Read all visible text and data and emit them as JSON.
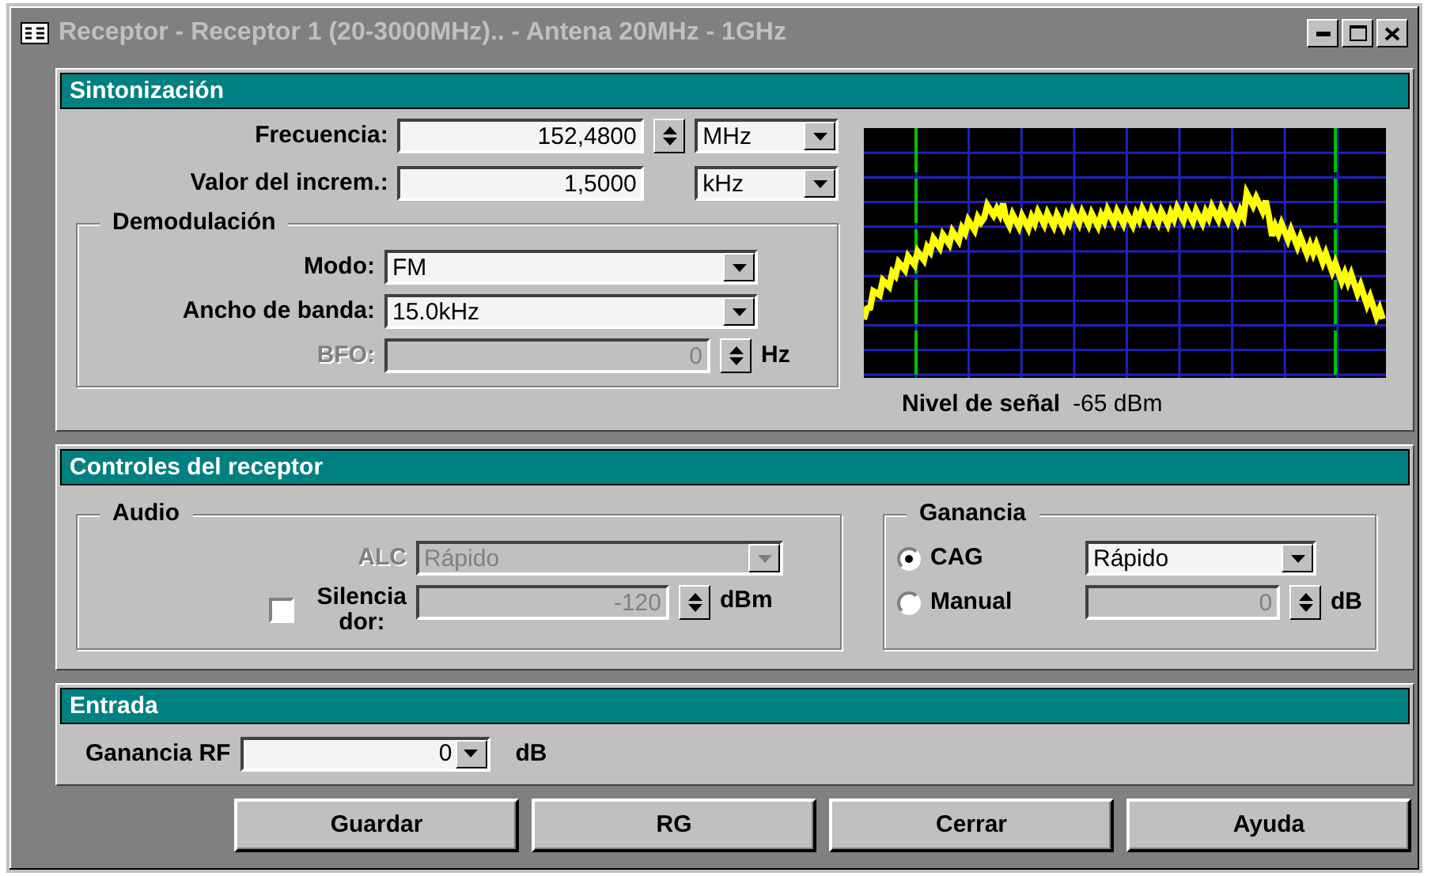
{
  "window": {
    "title": "Receptor - Receptor 1 (20-3000MHz).. - Antena 20MHz - 1GHz"
  },
  "sintonizacion": {
    "title": "Sintonización",
    "frecuencia": {
      "label": "Frecuencia:",
      "value": "152,4800",
      "unit": "MHz"
    },
    "incremento": {
      "label": "Valor del increm.:",
      "value": "1,5000",
      "unit": "kHz"
    },
    "demodulacion": {
      "title": "Demodulación",
      "modo": {
        "label": "Modo:",
        "value": "FM"
      },
      "ancho": {
        "label": "Ancho de banda:",
        "value": "15.0kHz"
      },
      "bfo": {
        "label": "BFO:",
        "value": "0",
        "unit": "Hz",
        "disabled": true
      }
    },
    "spectrum": {
      "kind": "picture",
      "signal_label": "Nivel de señal",
      "signal_value": "-65 dBm"
    }
  },
  "controles": {
    "title": "Controles del receptor",
    "audio": {
      "title": "Audio",
      "alc": {
        "label": "ALC",
        "value": "Rápido",
        "disabled": true
      },
      "silenciador": {
        "label": "Silencia\ndor:",
        "checked": false,
        "value": "-120",
        "unit": "dBm",
        "disabled": true
      }
    },
    "ganancia": {
      "title": "Ganancia",
      "modes": [
        {
          "label": "CAG",
          "selected": true
        },
        {
          "label": "Manual",
          "selected": false
        }
      ],
      "speed": {
        "value": "Rápido"
      },
      "manual": {
        "value": "0",
        "unit": "dB",
        "disabled": true
      }
    }
  },
  "entrada": {
    "title": "Entrada",
    "ganancia_rf": {
      "label": "Ganancia RF",
      "value": "0",
      "unit": "dB"
    }
  },
  "buttons": [
    {
      "label": "Guardar"
    },
    {
      "label": "RG"
    },
    {
      "label": "Cerrar"
    },
    {
      "label": "Ayuda"
    }
  ]
}
